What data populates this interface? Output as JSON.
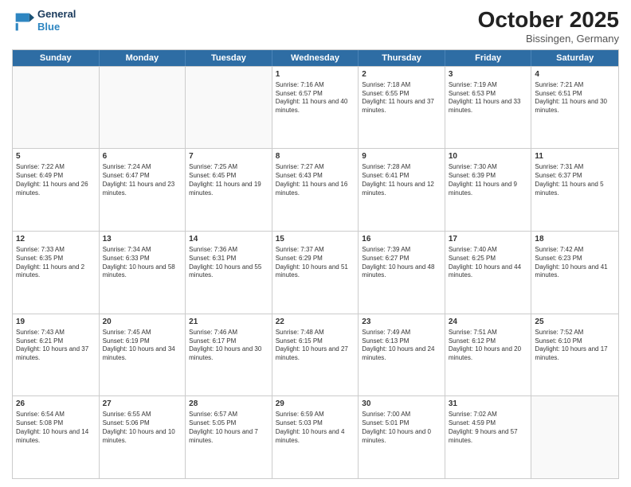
{
  "logo": {
    "line1": "General",
    "line2": "Blue"
  },
  "title": "October 2025",
  "subtitle": "Bissingen, Germany",
  "days": [
    "Sunday",
    "Monday",
    "Tuesday",
    "Wednesday",
    "Thursday",
    "Friday",
    "Saturday"
  ],
  "rows": [
    [
      {
        "num": "",
        "text": "",
        "empty": true
      },
      {
        "num": "",
        "text": "",
        "empty": true
      },
      {
        "num": "",
        "text": "",
        "empty": true
      },
      {
        "num": "1",
        "text": "Sunrise: 7:16 AM\nSunset: 6:57 PM\nDaylight: 11 hours and 40 minutes."
      },
      {
        "num": "2",
        "text": "Sunrise: 7:18 AM\nSunset: 6:55 PM\nDaylight: 11 hours and 37 minutes."
      },
      {
        "num": "3",
        "text": "Sunrise: 7:19 AM\nSunset: 6:53 PM\nDaylight: 11 hours and 33 minutes."
      },
      {
        "num": "4",
        "text": "Sunrise: 7:21 AM\nSunset: 6:51 PM\nDaylight: 11 hours and 30 minutes."
      }
    ],
    [
      {
        "num": "5",
        "text": "Sunrise: 7:22 AM\nSunset: 6:49 PM\nDaylight: 11 hours and 26 minutes."
      },
      {
        "num": "6",
        "text": "Sunrise: 7:24 AM\nSunset: 6:47 PM\nDaylight: 11 hours and 23 minutes."
      },
      {
        "num": "7",
        "text": "Sunrise: 7:25 AM\nSunset: 6:45 PM\nDaylight: 11 hours and 19 minutes."
      },
      {
        "num": "8",
        "text": "Sunrise: 7:27 AM\nSunset: 6:43 PM\nDaylight: 11 hours and 16 minutes."
      },
      {
        "num": "9",
        "text": "Sunrise: 7:28 AM\nSunset: 6:41 PM\nDaylight: 11 hours and 12 minutes."
      },
      {
        "num": "10",
        "text": "Sunrise: 7:30 AM\nSunset: 6:39 PM\nDaylight: 11 hours and 9 minutes."
      },
      {
        "num": "11",
        "text": "Sunrise: 7:31 AM\nSunset: 6:37 PM\nDaylight: 11 hours and 5 minutes."
      }
    ],
    [
      {
        "num": "12",
        "text": "Sunrise: 7:33 AM\nSunset: 6:35 PM\nDaylight: 11 hours and 2 minutes."
      },
      {
        "num": "13",
        "text": "Sunrise: 7:34 AM\nSunset: 6:33 PM\nDaylight: 10 hours and 58 minutes."
      },
      {
        "num": "14",
        "text": "Sunrise: 7:36 AM\nSunset: 6:31 PM\nDaylight: 10 hours and 55 minutes."
      },
      {
        "num": "15",
        "text": "Sunrise: 7:37 AM\nSunset: 6:29 PM\nDaylight: 10 hours and 51 minutes."
      },
      {
        "num": "16",
        "text": "Sunrise: 7:39 AM\nSunset: 6:27 PM\nDaylight: 10 hours and 48 minutes."
      },
      {
        "num": "17",
        "text": "Sunrise: 7:40 AM\nSunset: 6:25 PM\nDaylight: 10 hours and 44 minutes."
      },
      {
        "num": "18",
        "text": "Sunrise: 7:42 AM\nSunset: 6:23 PM\nDaylight: 10 hours and 41 minutes."
      }
    ],
    [
      {
        "num": "19",
        "text": "Sunrise: 7:43 AM\nSunset: 6:21 PM\nDaylight: 10 hours and 37 minutes."
      },
      {
        "num": "20",
        "text": "Sunrise: 7:45 AM\nSunset: 6:19 PM\nDaylight: 10 hours and 34 minutes."
      },
      {
        "num": "21",
        "text": "Sunrise: 7:46 AM\nSunset: 6:17 PM\nDaylight: 10 hours and 30 minutes."
      },
      {
        "num": "22",
        "text": "Sunrise: 7:48 AM\nSunset: 6:15 PM\nDaylight: 10 hours and 27 minutes."
      },
      {
        "num": "23",
        "text": "Sunrise: 7:49 AM\nSunset: 6:13 PM\nDaylight: 10 hours and 24 minutes."
      },
      {
        "num": "24",
        "text": "Sunrise: 7:51 AM\nSunset: 6:12 PM\nDaylight: 10 hours and 20 minutes."
      },
      {
        "num": "25",
        "text": "Sunrise: 7:52 AM\nSunset: 6:10 PM\nDaylight: 10 hours and 17 minutes."
      }
    ],
    [
      {
        "num": "26",
        "text": "Sunrise: 6:54 AM\nSunset: 5:08 PM\nDaylight: 10 hours and 14 minutes."
      },
      {
        "num": "27",
        "text": "Sunrise: 6:55 AM\nSunset: 5:06 PM\nDaylight: 10 hours and 10 minutes."
      },
      {
        "num": "28",
        "text": "Sunrise: 6:57 AM\nSunset: 5:05 PM\nDaylight: 10 hours and 7 minutes."
      },
      {
        "num": "29",
        "text": "Sunrise: 6:59 AM\nSunset: 5:03 PM\nDaylight: 10 hours and 4 minutes."
      },
      {
        "num": "30",
        "text": "Sunrise: 7:00 AM\nSunset: 5:01 PM\nDaylight: 10 hours and 0 minutes."
      },
      {
        "num": "31",
        "text": "Sunrise: 7:02 AM\nSunset: 4:59 PM\nDaylight: 9 hours and 57 minutes."
      },
      {
        "num": "",
        "text": "",
        "empty": true
      }
    ]
  ]
}
